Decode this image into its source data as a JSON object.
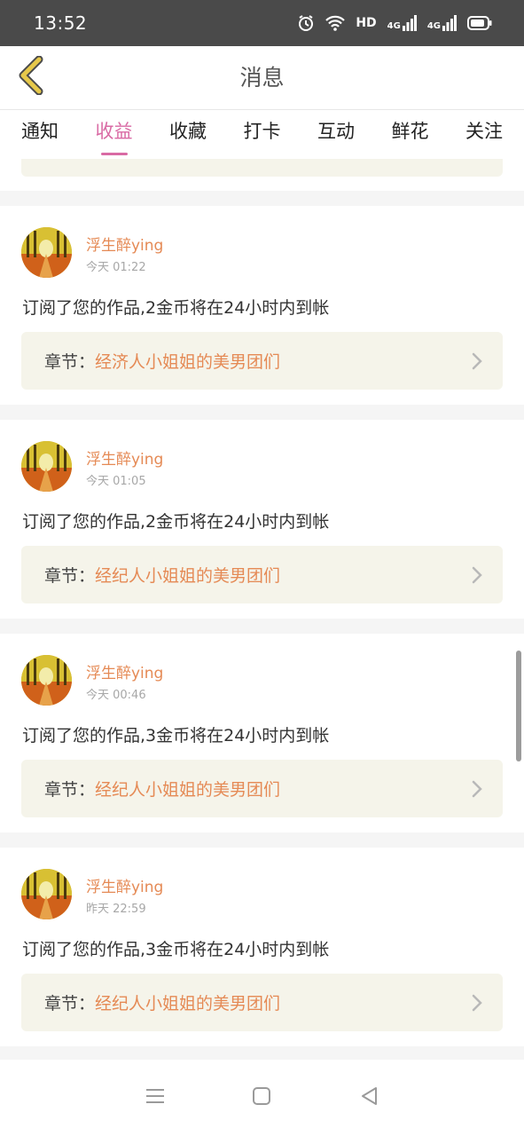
{
  "status_bar": {
    "time": "13:52",
    "network_label": "HD",
    "signal_labels": [
      "4G",
      "4G"
    ],
    "icons": [
      "alarm-icon",
      "wifi-icon",
      "signal-icon",
      "signal-icon",
      "battery-icon"
    ]
  },
  "header": {
    "title": "消息",
    "back_icon": "chevron-left-icon",
    "accent": "#e6c84a"
  },
  "tabs": [
    {
      "label": "通知",
      "active": false
    },
    {
      "label": "收益",
      "active": true
    },
    {
      "label": "收藏",
      "active": false
    },
    {
      "label": "打卡",
      "active": false
    },
    {
      "label": "互动",
      "active": false
    },
    {
      "label": "鲜花",
      "active": false
    },
    {
      "label": "关注",
      "active": false
    }
  ],
  "colors": {
    "active_tab": "#d96aa4",
    "username": "#e58a55",
    "chapter_bg": "#f5f4ea"
  },
  "messages": [
    {
      "username": "浮生醉ying",
      "time": "今天 01:22",
      "text": "订阅了您的作品,2金币将在24小时内到帐",
      "chapter_label": "章节：",
      "chapter_name": "经济人小姐姐的美男团们"
    },
    {
      "username": "浮生醉ying",
      "time": "今天 01:05",
      "text": "订阅了您的作品,2金币将在24小时内到帐",
      "chapter_label": "章节：",
      "chapter_name": "经纪人小姐姐的美男团们"
    },
    {
      "username": "浮生醉ying",
      "time": "今天 00:46",
      "text": "订阅了您的作品,3金币将在24小时内到帐",
      "chapter_label": "章节：",
      "chapter_name": "经纪人小姐姐的美男团们"
    },
    {
      "username": "浮生醉ying",
      "time": "昨天 22:59",
      "text": "订阅了您的作品,3金币将在24小时内到帐",
      "chapter_label": "章节：",
      "chapter_name": "经纪人小姐姐的美男团们"
    }
  ],
  "nav_bar": {
    "icons": [
      "menu-icon",
      "home-icon",
      "back-icon"
    ]
  }
}
